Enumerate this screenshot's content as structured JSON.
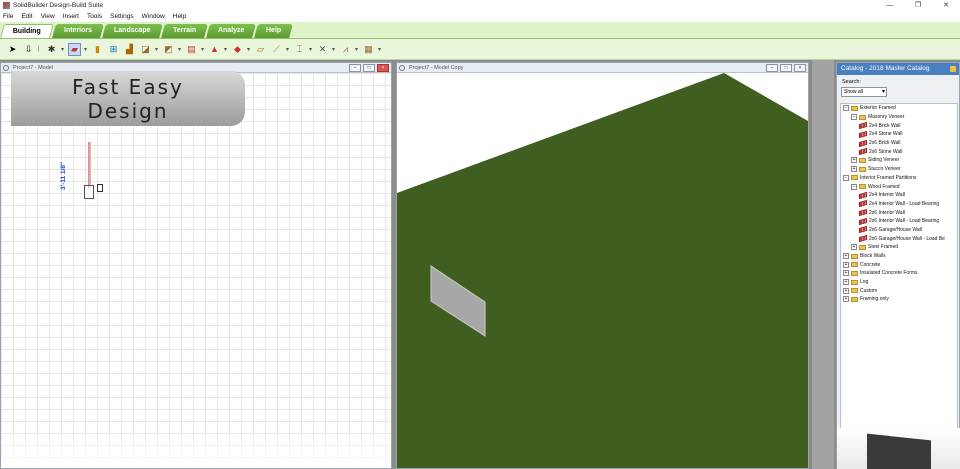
{
  "app": {
    "title": "SolidBuilder Design-Build Suite",
    "window_controls": [
      "—",
      "❐",
      "✕"
    ]
  },
  "menu": [
    "File",
    "Edit",
    "View",
    "Insert",
    "Tools",
    "Settings",
    "Window",
    "Help"
  ],
  "ribbon": {
    "tabs": [
      {
        "label": "Building",
        "active": true
      },
      {
        "label": "Interiors",
        "active": false
      },
      {
        "label": "Landscape",
        "active": false
      },
      {
        "label": "Terrain",
        "active": false
      },
      {
        "label": "Analyze",
        "active": false
      },
      {
        "label": "Help",
        "active": false
      }
    ],
    "tools": [
      "select-arrow-icon",
      "pointer-icon",
      "roof-icon",
      "wall-icon",
      "door-icon",
      "window-icon",
      "stairs-icon",
      "floor-icon",
      "deck-icon",
      "trim-icon",
      "cabinet-icon",
      "roof-plane-icon",
      "dormer-icon",
      "framing-icon",
      "column-icon",
      "beam-icon",
      "joist-icon",
      "rafter-icon",
      "truss-icon"
    ]
  },
  "plan_view": {
    "title": "Project7 - Model",
    "banner_line1": "Fast Easy",
    "banner_line2": "Design",
    "dimension": "3'-11 1/8\""
  },
  "view_3d": {
    "title": "Project7 - Model Copy",
    "ground_color": "#3f5e1f"
  },
  "catalog": {
    "title": "Catalog - 2018 Master Catalog",
    "search_label": "Search:",
    "search_value": "Show all",
    "tree": [
      {
        "level": 0,
        "type": "folder",
        "label": "Exterior Framed",
        "expander": "−"
      },
      {
        "level": 1,
        "type": "folder",
        "label": "Masonry Veneer",
        "expander": "−"
      },
      {
        "level": 2,
        "type": "wall",
        "label": "2x4 Brick Wall"
      },
      {
        "level": 2,
        "type": "wall",
        "label": "2x4 Stone Wall"
      },
      {
        "level": 2,
        "type": "wall",
        "label": "2x6 Brick Wall"
      },
      {
        "level": 2,
        "type": "wall",
        "label": "2x6 Stone Wall"
      },
      {
        "level": 1,
        "type": "folder",
        "label": "Siding Veneer",
        "expander": "+"
      },
      {
        "level": 1,
        "type": "folder",
        "label": "Stucco Veneer",
        "expander": "+"
      },
      {
        "level": 0,
        "type": "folder",
        "label": "Interior Framed Partitions",
        "expander": "−"
      },
      {
        "level": 1,
        "type": "folder",
        "label": "Wood Framed",
        "expander": "−"
      },
      {
        "level": 2,
        "type": "wall",
        "label": "2x4 Interior Wall"
      },
      {
        "level": 2,
        "type": "wall",
        "label": "2x4 Interior Wall - Load Bearing"
      },
      {
        "level": 2,
        "type": "wall",
        "label": "2x6 Interior Wall"
      },
      {
        "level": 2,
        "type": "wall",
        "label": "2x6 Interior Wall - Load Bearing"
      },
      {
        "level": 2,
        "type": "wall",
        "label": "2x6 Garage/House Wall"
      },
      {
        "level": 2,
        "type": "wall",
        "label": "2x6 Garage/House Wall - Load Be"
      },
      {
        "level": 1,
        "type": "folder",
        "label": "Steel Framed",
        "expander": "+"
      },
      {
        "level": 0,
        "type": "folder",
        "label": "Block Walls",
        "expander": "+"
      },
      {
        "level": 0,
        "type": "folder",
        "label": "Concrete",
        "expander": "+"
      },
      {
        "level": 0,
        "type": "folder",
        "label": "Insulated Concrete Forms",
        "expander": "+"
      },
      {
        "level": 0,
        "type": "folder",
        "label": "Log",
        "expander": "+"
      },
      {
        "level": 0,
        "type": "folder",
        "label": "Custom",
        "expander": "+"
      },
      {
        "level": 0,
        "type": "folder",
        "label": "Framing only",
        "expander": "+"
      }
    ]
  }
}
